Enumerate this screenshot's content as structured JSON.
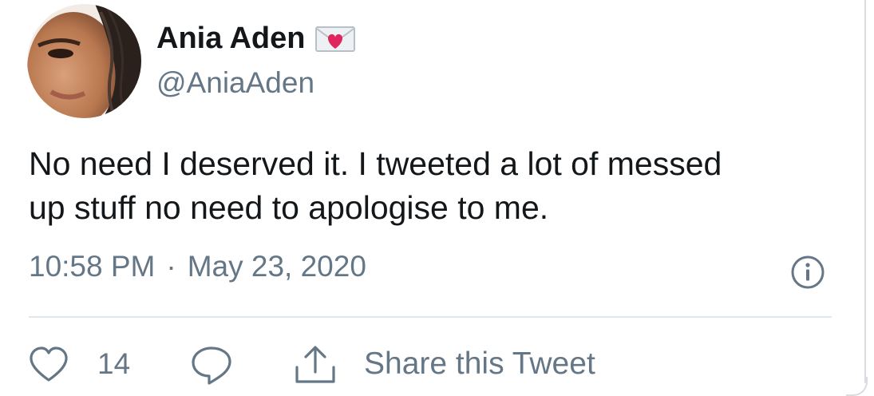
{
  "tweet": {
    "author": {
      "display_name": "Ania Aden",
      "badge_icon": "love-letter-icon",
      "handle": "@AniaAden",
      "avatar_icon": "avatar-photo"
    },
    "text_lines": [
      "No need I deserved it. I tweeted a lot of messed",
      "up stuff no need to apologise to me."
    ],
    "time": "10:58 PM",
    "separator": "·",
    "date": "May 23, 2020",
    "info_icon": "info-icon"
  },
  "actions": {
    "like_icon": "heart-icon",
    "like_count": "14",
    "reply_icon": "reply-icon",
    "share_icon": "share-icon",
    "share_label": "Share this Tweet"
  },
  "colors": {
    "text_primary": "#14171a",
    "text_secondary": "#657786",
    "divider": "#e1e8ed",
    "badge_heart": "#e0245e"
  }
}
